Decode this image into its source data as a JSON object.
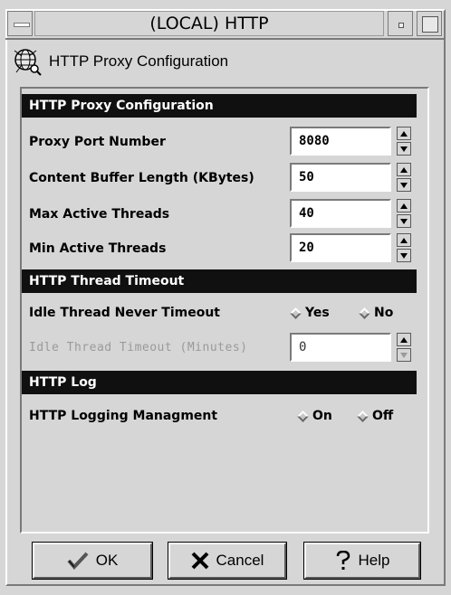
{
  "window": {
    "title": "(LOCAL) HTTP"
  },
  "heading": {
    "title": "HTTP Proxy Configuration",
    "icon": "globe-web-icon"
  },
  "sections": {
    "proxy": "HTTP Proxy Configuration",
    "thread": "HTTP Thread Timeout",
    "log": "HTTP Log"
  },
  "fields": {
    "port": {
      "label": "Proxy Port Number",
      "value": "8080"
    },
    "buffer": {
      "label": "Content Buffer Length (KBytes)",
      "value": "50"
    },
    "max_threads": {
      "label": "Max Active Threads",
      "value": "40"
    },
    "min_threads": {
      "label": "Min Active Threads",
      "value": "20"
    },
    "idle_timeout": {
      "label": "Idle Thread Timeout (Minutes)",
      "value": "0",
      "disabled": true
    }
  },
  "radios": {
    "idle_never": {
      "label": "Idle Thread Never Timeout",
      "yes": "Yes",
      "no": "No"
    },
    "logging": {
      "label": "HTTP Logging Managment",
      "on": "On",
      "off": "Off"
    }
  },
  "buttons": {
    "ok": "OK",
    "cancel": "Cancel",
    "help": "Help"
  },
  "colors": {
    "background": "#d6d6d6",
    "section_bar": "#101010",
    "field_bg": "#ffffff"
  }
}
